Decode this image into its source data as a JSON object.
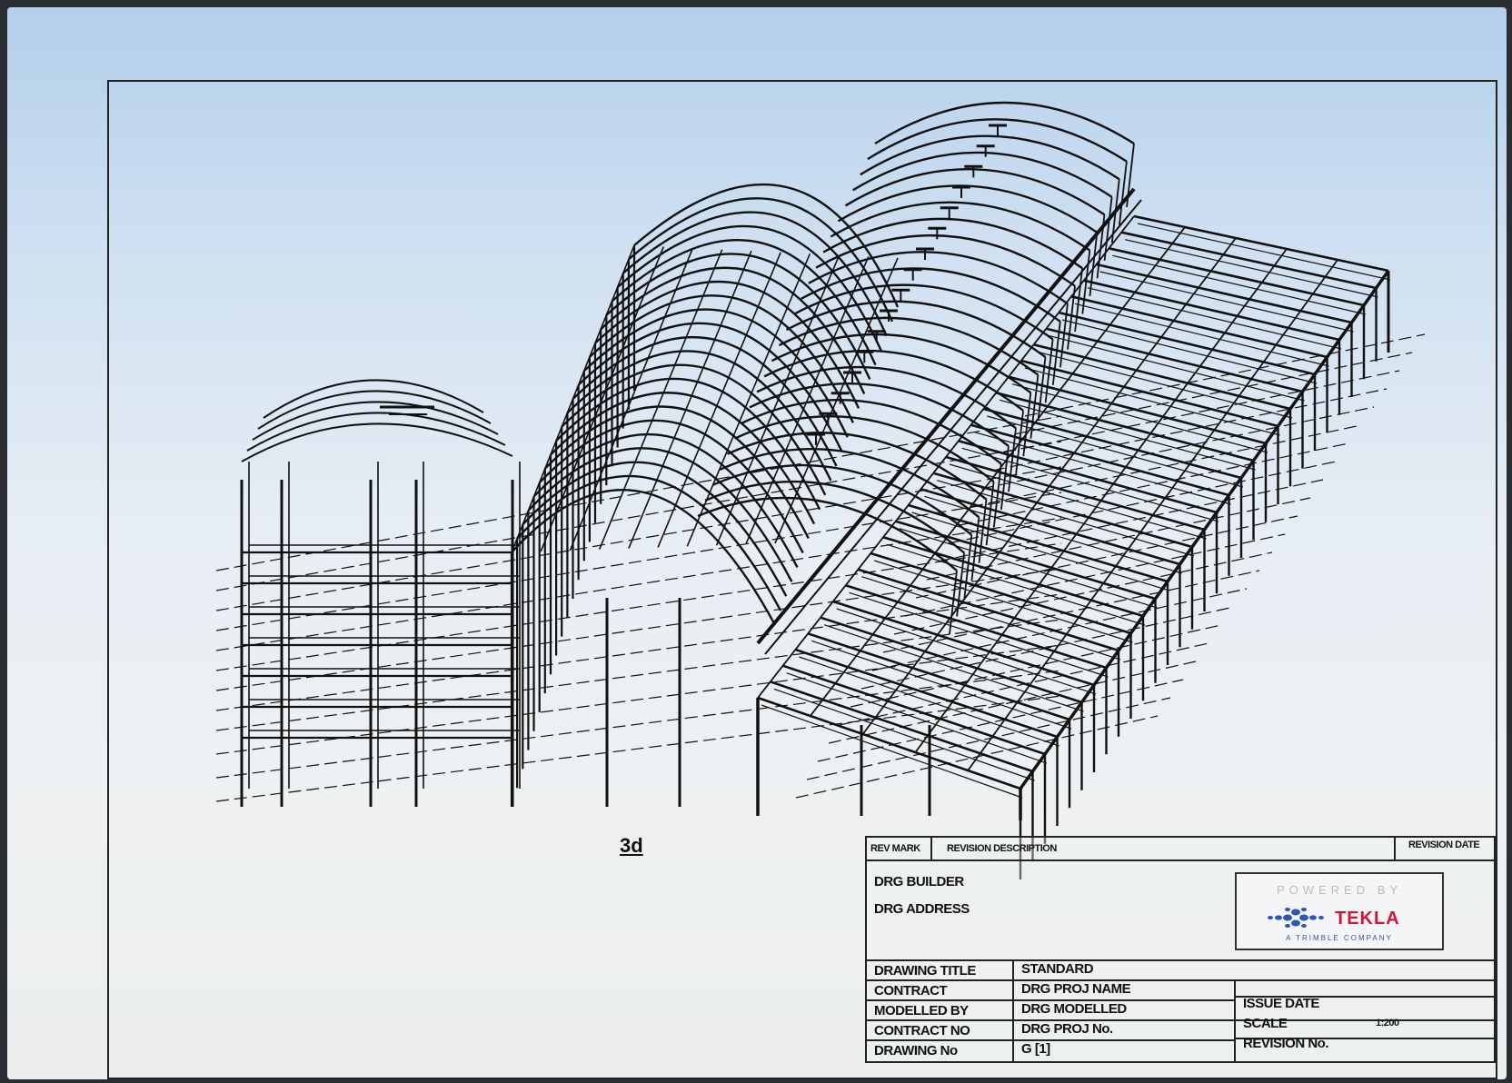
{
  "drawing": {
    "view_label": "3d"
  },
  "title_block": {
    "rev_mark_label": "REV MARK",
    "revision_description_label": "REVISION DESCRIPTION",
    "revision_date_label": "REVISION DATE",
    "builder": "DRG BUILDER",
    "address": "DRG ADDRESS",
    "logo": {
      "top": "POWERED BY",
      "brand": "TEKLA",
      "sub": "A TRIMBLE COMPANY",
      "brand_color": "#d0143c",
      "icon_color": "#2f56b5"
    },
    "fields": [
      {
        "label": "DRAWING TITLE",
        "value": "STANDARD"
      },
      {
        "label": "CONTRACT",
        "value": "DRG PROJ NAME"
      },
      {
        "label": "MODELLED BY",
        "value": "DRG MODELLED"
      },
      {
        "label": "CONTRACT NO",
        "value": "DRG PROJ No."
      },
      {
        "label": "DRAWING No",
        "value": "G  [1]"
      }
    ],
    "issue_date_label": "ISSUE DATE",
    "scale_label": "SCALE",
    "scale_value": "1:200",
    "revision_no_label": "REVISION No."
  }
}
